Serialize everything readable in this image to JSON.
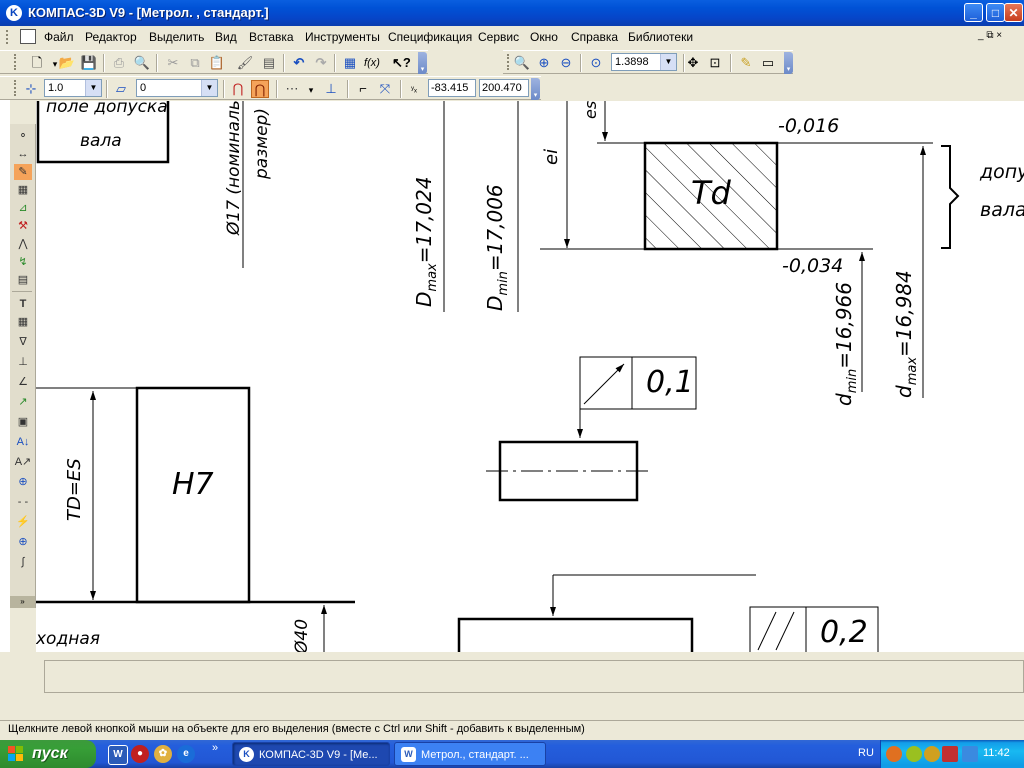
{
  "window": {
    "title": "КОМПАС-3D V9 - [Метрол. , стандарт.]",
    "buttons": [
      "_",
      "□",
      "✕"
    ]
  },
  "menu": {
    "items": [
      "Файл",
      "Редактор",
      "Выделить",
      "Вид",
      "Вставка",
      "Инструменты",
      "Спецификация",
      "Сервис",
      "Окно",
      "Справка",
      "Библиотеки"
    ],
    "mdi_buttons": "_ ⧉ ×"
  },
  "toolbar1": {
    "zoom_value": "1.3898"
  },
  "toolbar2": {
    "line_scale": "1.0",
    "layer": "0",
    "coord_x": "-83.415",
    "coord_y": "200.470"
  },
  "drawing": {
    "texts": {
      "pole_dopuska": "поле допуска",
      "vala": "вала",
      "diam_nominal_a": "Ø17 (номиналь",
      "diam_nominal_b": "размер)",
      "Dmax_prefix": "D",
      "Dmax_sub": "max",
      "Dmax_val": "=17,024",
      "Dmin_prefix": "D",
      "Dmin_sub": "min",
      "Dmin_val": "=17,006",
      "ei": "ei",
      "es_partial": "es",
      "upper_dev": "-0,016",
      "lower_dev": "-0,034",
      "Td": "Td",
      "dopusk": "допу",
      "vala_right": "вала",
      "dmin_prefix": "d",
      "dmin_sub": "min",
      "dmin_val": "=16,966",
      "dmax_prefix": "d",
      "dmax_sub": "max",
      "dmax_val": "=16,984",
      "tol_01": "0,1",
      "tol_02": "0,2",
      "TD_ES": "TD=ES",
      "H7": "H7",
      "iskhodnaya": "ходная",
      "diam40": "Ø40"
    }
  },
  "status": {
    "text": "Щелкните левой кнопкой мыши на объекте для его выделения (вместе с Ctrl или Shift - добавить к выделенным)"
  },
  "taskbar": {
    "start": "пуск",
    "tasks": [
      "КОМПАС-3D V9 - [Ме...",
      "Метрол., стандарт. ..."
    ],
    "lang": "RU",
    "clock": "11:42"
  }
}
